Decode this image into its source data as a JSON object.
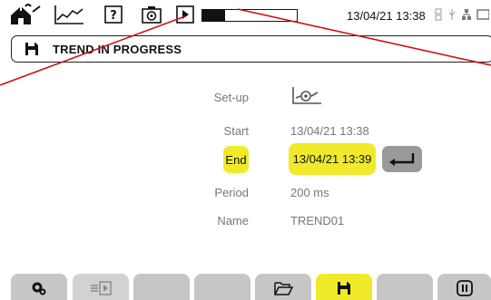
{
  "status_bar": {
    "icons": [
      "home-wave-icon",
      "trend-graph-icon",
      "help-icon",
      "camera-icon",
      "play-icon"
    ],
    "recording_progress": 0.24,
    "datetime": "13/04/21 13:38",
    "right_icons": [
      "network-icon",
      "usb-icon",
      "battery-icon"
    ]
  },
  "header": {
    "icon": "save-icon",
    "title": "TREND IN PROGRESS"
  },
  "form": {
    "setup_label": "Set-up",
    "setup_icon": "trend-setup-icon",
    "start_label": "Start",
    "start_value": "13/04/21 13:38",
    "end_label": "End",
    "end_value": "13/04/21 13:39",
    "enter_icon": "enter-icon",
    "period_label": "Period",
    "period_value": "200 ms",
    "name_label": "Name",
    "name_value": "TREND01"
  },
  "bottom_tabs": [
    {
      "icon": "settings-icon",
      "active": false
    },
    {
      "icon": "export-icon",
      "active": false
    },
    {
      "icon": "",
      "active": false
    },
    {
      "icon": "",
      "active": false
    },
    {
      "icon": "folder-icon",
      "active": false
    },
    {
      "icon": "save-icon",
      "active": true
    },
    {
      "icon": "",
      "active": false
    },
    {
      "icon": "pause-icon",
      "active": false
    }
  ],
  "colors": {
    "highlight": "#f0ea2a",
    "tab_gray": "#c6c6c6",
    "annotation_line": "#cc1111"
  }
}
